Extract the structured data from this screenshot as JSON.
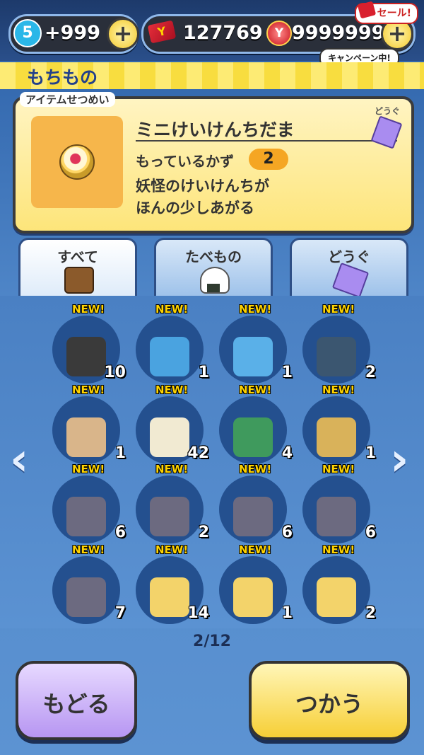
{
  "status": {
    "level": "5",
    "stamina": "+999",
    "tickets": "127769",
    "ycoins": "9999999",
    "sale_label": "セール!",
    "campaign_label": "キャンペーン中!"
  },
  "header": {
    "title": "もちもの"
  },
  "description": {
    "section_label": "アイテムせつめい",
    "item_name": "ミニけいけんちだま",
    "category": "どうぐ",
    "quantity_label": "もっているかず",
    "quantity": "2",
    "effect": "妖怪のけいけんちが\nほんの少しあがる"
  },
  "tabs": [
    {
      "label": "すべて",
      "icon": "bag-icon",
      "active": true
    },
    {
      "label": "たべもの",
      "icon": "onigiri-icon",
      "active": false
    },
    {
      "label": "どうぐ",
      "icon": "scroll-icon",
      "active": false
    }
  ],
  "new_label": "NEW!",
  "items": [
    {
      "icon": "spiked-collar-icon",
      "count": "10",
      "color": "#3a3a3a"
    },
    {
      "icon": "purple-book-icon",
      "count": "1",
      "color": "#4aa3e0"
    },
    {
      "icon": "face-book-icon",
      "count": "1",
      "color": "#5ab0e8"
    },
    {
      "icon": "stone-tablet-icon",
      "count": "2",
      "color": "#3b5670"
    },
    {
      "icon": "gift-box-icon",
      "count": "1",
      "color": "#d9b58a"
    },
    {
      "icon": "tofu-icon",
      "count": "42",
      "color": "#f1ead2"
    },
    {
      "icon": "charm-icon",
      "count": "4",
      "color": "#3f9a5d"
    },
    {
      "icon": "ancient-scroll-icon",
      "count": "1",
      "color": "#d9b25a"
    },
    {
      "icon": "letter-1-icon",
      "count": "6",
      "color": "#6c6a80"
    },
    {
      "icon": "letter-2-icon",
      "count": "2",
      "color": "#6c6a80"
    },
    {
      "icon": "letter-3-icon",
      "count": "6",
      "color": "#6c6a80"
    },
    {
      "icon": "letter-4-icon",
      "count": "6",
      "color": "#6c6a80"
    },
    {
      "icon": "letter-5-icon",
      "count": "7",
      "color": "#6c6a80"
    },
    {
      "icon": "yokai-card-icon",
      "count": "14",
      "color": "#f3d36a"
    },
    {
      "icon": "yokai-card-icon",
      "count": "1",
      "color": "#f3d36a"
    },
    {
      "icon": "yokai-card-icon",
      "count": "2",
      "color": "#f3d36a"
    }
  ],
  "pagination": "2/12",
  "buttons": {
    "back": "もどる",
    "use": "つかう"
  }
}
